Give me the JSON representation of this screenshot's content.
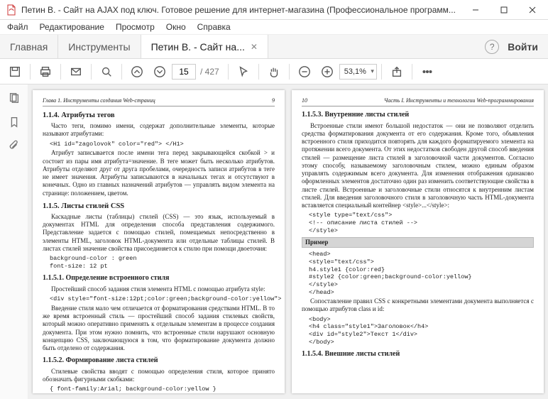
{
  "window": {
    "title": "Петин В. - Сайт на AJAX под ключ. Готовое решение для интернет-магазина (Профессиональное программ..."
  },
  "menu": {
    "file": "Файл",
    "edit": "Редактирование",
    "view": "Просмотр",
    "window": "Окно",
    "help": "Справка"
  },
  "tabs": {
    "home": "Главная",
    "tools": "Инструменты",
    "doc": "Петин В. - Сайт на...",
    "login": "Войти"
  },
  "toolbar": {
    "page_current": "15",
    "page_total": "/ 427",
    "zoom": "53,1%"
  },
  "left": {
    "runhead_left": "Глава 1. Инструменты создания Web-страниц",
    "runhead_right": "9",
    "h114": "1.1.4. Атрибуты тегов",
    "p1": "Часто теги, помимо имени, содержат дополнительные элементы, которые называют атрибутами:",
    "code1": "<H1 id=\"zagolovok\" color=\"red\"> </H1>",
    "p2": "Атрибут записывается после имени тега перед закрывающейся скобкой > и состоит из пары имя атрибута=значение. В теге может быть несколько атрибутов. Атрибуты отделяют друг от друга пробелами, очередность записи атрибутов в теге не имеет значения. Атрибуты записываются в начальных тегах и отсутствуют в конечных. Одно из главных назначений атрибутов — управлять видом элемента на странице: положением, цветом.",
    "h115": "1.1.5. Листы стилей CSS",
    "p3": "Каскадные листы (таблицы) стилей (CSS) — это язык, используемый в документах HTML для определения способа представления содержимого. Представление задается с помощью стилей, помещаемых непосредственно в элементы HTML, заголовок HTML-документа или отдельные таблицы стилей. В листах стилей значение свойства присоединяется к стилю при помощи двоеточия:",
    "code2": "background-color : green\nfont-size: 12 pt",
    "h1151": "1.1.5.1. Определение встроенного стиля",
    "p4": "Простейший способ задания стиля элемента HTML с помощью атрибута style:",
    "code3": "<div style=\"font-size:12pt;color:green;background-color:yellow\">",
    "p5": "Введение стиля мало чем отличается от форматирования средствами HTML. В то же время встроенный стиль — простейший способ задания стилевых свойств, который можно оперативно применять к отдельным элементам в процессе создания документа. При этом нужно помнить, что встроенные стили нарушают основную концепцию CSS, заключающуюся в том, что форматирование документа должно быть отделено от содержания.",
    "h1152": "1.1.5.2. Формирование листа стилей",
    "p6": "Стилевые свойства вводят с помощью определения стиля, которое принято обозначать фигурными скобками:",
    "code4": "{ font-family:Arial; background-color:yellow }\n{visibility:hidden}"
  },
  "right": {
    "runhead_left": "10",
    "runhead_right": "Часть I. Инструменты и технологии Web-программирования",
    "h1153": "1.1.5.3. Внутренние листы стилей",
    "p1": "Встроенные стили имеют большой недостаток — они не позволяют отделить средства форматирования документа от его содержания. Кроме того, объявления встроенного стиля приходится повторять для каждого форматируемого элемента на протяжении всего документа. От этих недостатков свободен другой способ введения стилей — размещение листа стилей в заголовочной части документов. Согласно этому способу, называемому заголовочным стилем, можно единым образом управлять содержимым всего документа. Для изменения отображения одинаково оформленных элементов достаточно один раз изменить соответствующие свойства в листе стилей. Встроенные и заголовочные стили относятся к внутренним листам стилей. Для введения заголовочного стиля в заголовочную часть HTML-документа вставляется специальный контейнер  <style>...</style>:",
    "code1": "<style type=\"text/css\">\n<!-- описание листа стилей -->\n</style>",
    "example_label": "Пример",
    "code2": "<head>\n<style=\"text/css\">\nh4.style1 {color:red}\n#style2 {color:green;background-color:yellow}\n</style>\n</head>",
    "p2": "Сопоставление правил CSS с конкретными элементами документа выполняется с помощью атрибутов class и id:",
    "code3": "<body>\n<h4 class=\"style1\">Заголовок</h4>\n<div id=\"style2\">Текст 1</div>\n</body>",
    "h1154": "1.1.5.4. Внешние листы стилей"
  }
}
